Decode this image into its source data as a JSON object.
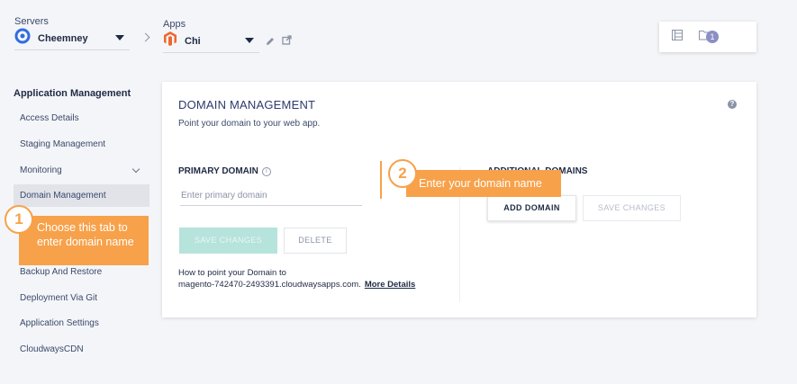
{
  "servers": {
    "label": "Servers",
    "selected": "Cheemney"
  },
  "apps": {
    "label": "Apps",
    "selected": "Chi"
  },
  "toolbar": {
    "badge_count": "1"
  },
  "sidebar": {
    "title": "Application Management",
    "items": [
      {
        "label": "Access Details"
      },
      {
        "label": "Staging Management"
      },
      {
        "label": "Monitoring"
      },
      {
        "label": "Domain Management"
      },
      {
        "label": "Backup And Restore"
      },
      {
        "label": "Deployment Via Git"
      },
      {
        "label": "Application Settings"
      },
      {
        "label": "CloudwaysCDN"
      }
    ]
  },
  "tooltips": {
    "step1": {
      "number": "1",
      "text": "Choose this tab to enter domain name"
    },
    "step2": {
      "number": "2",
      "text": "Enter your domain name"
    }
  },
  "card": {
    "title": "DOMAIN MANAGEMENT",
    "subtitle": "Point your domain to your web app.",
    "help": "?",
    "primary": {
      "label": "PRIMARY DOMAIN",
      "info": "i",
      "placeholder": "Enter primary domain",
      "save_label": "SAVE CHANGES",
      "delete_label": "DELETE"
    },
    "additional": {
      "label": "ADDITIONAL DOMAINS",
      "add_label": "ADD DOMAIN",
      "save_label": "SAVE CHANGES"
    },
    "howto": {
      "line1": "How to point your Domain to",
      "domain": "magento-742470-2493391.cloudwaysapps.com.",
      "link": "More Details"
    }
  },
  "colors": {
    "accent": "#f7a14a",
    "title": "#2d3a6d",
    "teal_disabled": "#b6e3dc"
  }
}
